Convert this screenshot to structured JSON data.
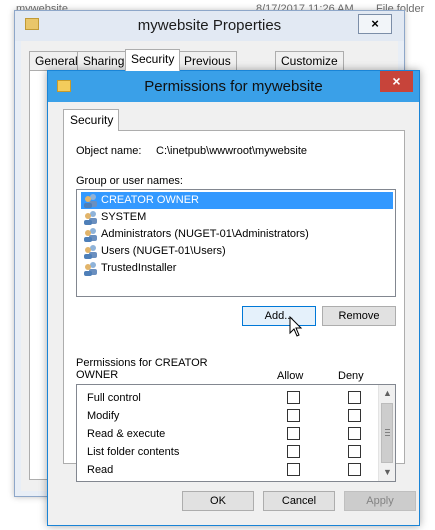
{
  "explorer": {
    "name": "mywebsite",
    "date": "8/17/2017 11:26 AM",
    "type": "File folder"
  },
  "properties": {
    "title": "mywebsite Properties",
    "close_label": "×",
    "tabs": [
      {
        "label": "General"
      },
      {
        "label": "Sharing"
      },
      {
        "label": "Security"
      },
      {
        "label": "Previous Versions"
      },
      {
        "label": "Customize"
      }
    ]
  },
  "permissions": {
    "title": "Permissions for mywebsite",
    "close_label": "×",
    "tab_label": "Security",
    "object_name_label": "Object name:",
    "object_name_value": "C:\\inetpub\\wwwroot\\mywebsite",
    "group_label": "Group or user names:",
    "users": [
      {
        "label": "CREATOR OWNER",
        "selected": true
      },
      {
        "label": "SYSTEM",
        "selected": false
      },
      {
        "label": "Administrators (NUGET-01\\Administrators)",
        "selected": false
      },
      {
        "label": "Users (NUGET-01\\Users)",
        "selected": false
      },
      {
        "label": "TrustedInstaller",
        "selected": false
      }
    ],
    "add_label": "Add...",
    "remove_label": "Remove",
    "permissions_for_label": "Permissions for CREATOR OWNER",
    "allow_label": "Allow",
    "deny_label": "Deny",
    "rows": [
      {
        "label": "Full control"
      },
      {
        "label": "Modify"
      },
      {
        "label": "Read & execute"
      },
      {
        "label": "List folder contents"
      },
      {
        "label": "Read"
      }
    ],
    "ok_label": "OK",
    "cancel_label": "Cancel",
    "apply_label": "Apply"
  }
}
